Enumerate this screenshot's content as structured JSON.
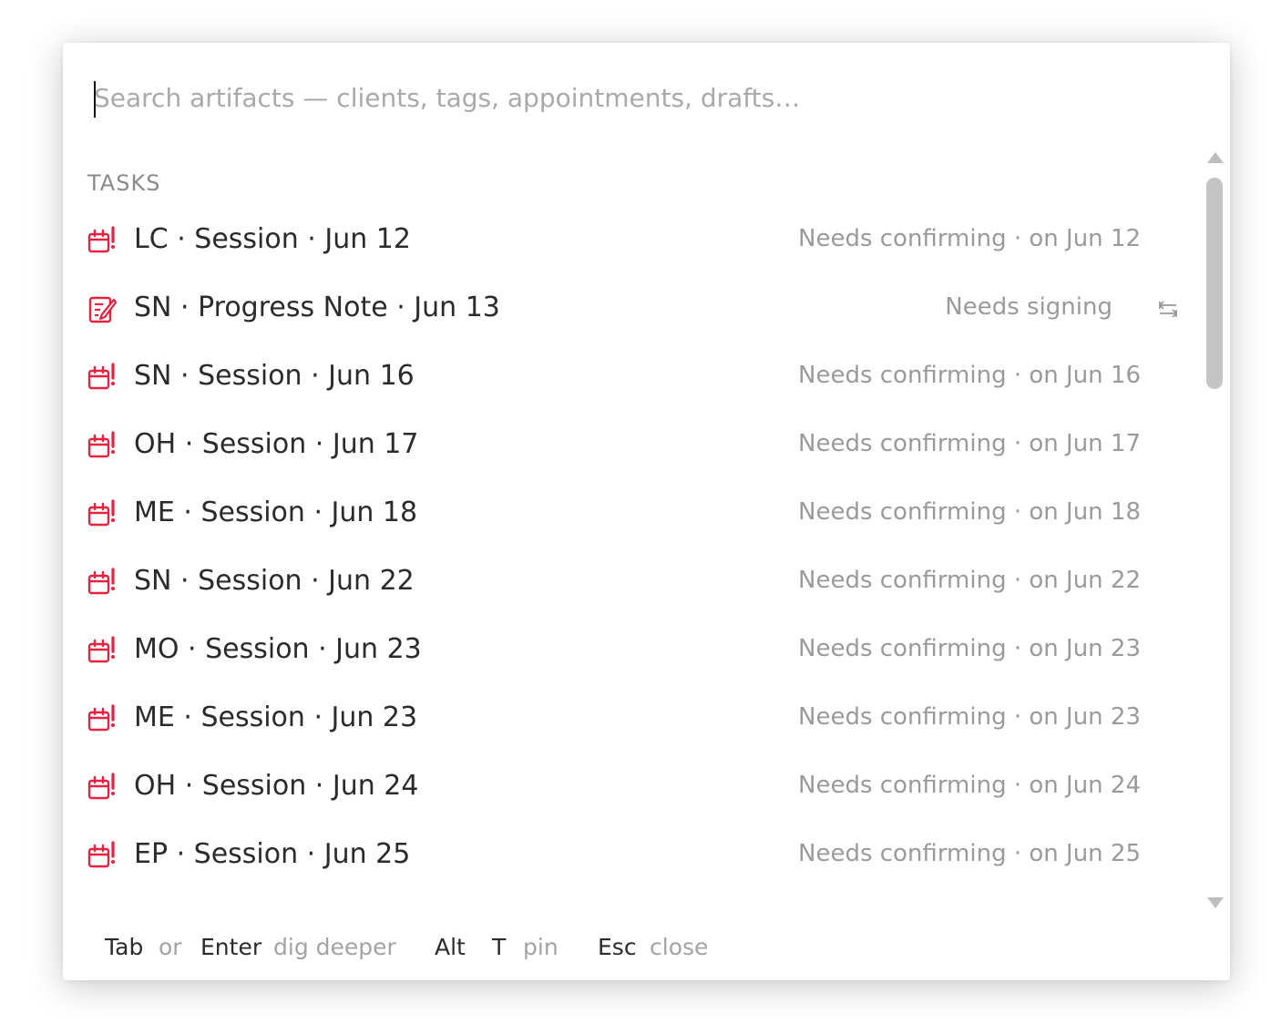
{
  "search": {
    "placeholder": "Search artifacts — clients, tags, appointments, drafts…",
    "value": ""
  },
  "section": {
    "title": "TASKS"
  },
  "tasks": [
    {
      "icon": "calendar-alert-icon",
      "title": "LC · Session · Jun 12",
      "status": "Needs confirming · on Jun 12"
    },
    {
      "icon": "note-edit-icon",
      "title": "SN · Progress Note · Jun 13",
      "status": "Needs signing",
      "action_icon": "swap-icon"
    },
    {
      "icon": "calendar-alert-icon",
      "title": "SN · Session · Jun 16",
      "status": "Needs confirming · on Jun 16"
    },
    {
      "icon": "calendar-alert-icon",
      "title": "OH · Session · Jun 17",
      "status": "Needs confirming · on Jun 17"
    },
    {
      "icon": "calendar-alert-icon",
      "title": "ME · Session · Jun 18",
      "status": "Needs confirming · on Jun 18"
    },
    {
      "icon": "calendar-alert-icon",
      "title": "SN · Session · Jun 22",
      "status": "Needs confirming · on Jun 22"
    },
    {
      "icon": "calendar-alert-icon",
      "title": "MO · Session · Jun 23",
      "status": "Needs confirming · on Jun 23"
    },
    {
      "icon": "calendar-alert-icon",
      "title": "ME · Session · Jun 23",
      "status": "Needs confirming · on Jun 23"
    },
    {
      "icon": "calendar-alert-icon",
      "title": "OH · Session · Jun 24",
      "status": "Needs confirming · on Jun 24"
    },
    {
      "icon": "calendar-alert-icon",
      "title": "EP · Session · Jun 25",
      "status": "Needs confirming · on Jun 25"
    }
  ],
  "footer": {
    "tab_key": "Tab",
    "or_text": "or",
    "enter_key": "Enter",
    "dig_deeper_text": "dig deeper",
    "alt_key": "Alt",
    "t_key": "T",
    "pin_text": "pin",
    "esc_key": "Esc",
    "close_text": "close"
  },
  "colors": {
    "accent": "#e8213f",
    "muted_text": "#9a9a9a",
    "primary_text": "#2b2b2b"
  }
}
